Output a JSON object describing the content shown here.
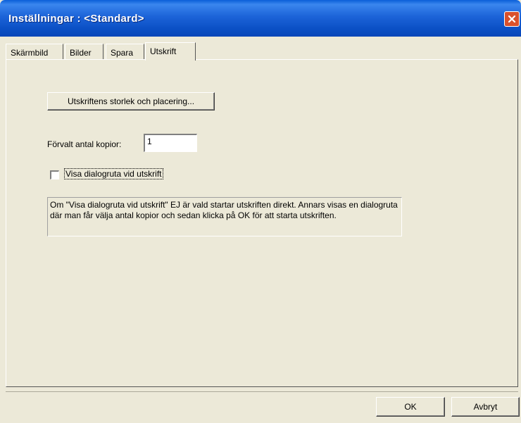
{
  "window": {
    "title": "Inställningar : <Standard>"
  },
  "tabs": [
    {
      "label": "Skärmbild"
    },
    {
      "label": "Bilder"
    },
    {
      "label": "Spara"
    },
    {
      "label": "Utskrift",
      "active": true
    }
  ],
  "print": {
    "size_button_label": "Utskriftens storlek och placering...",
    "copies_label": "Förvalt antal kopior:",
    "copies_value": "1",
    "dialog_checkbox_label": "Visa dialogruta vid utskrift",
    "dialog_checkbox_checked": false,
    "info_text": "Om \"Visa dialogruta vid utskrift\" EJ är vald startar utskriften direkt. Annars visas en dialogruta där man får välja antal kopior och sedan klicka på OK för att starta utskriften."
  },
  "footer": {
    "ok_label": "OK",
    "cancel_label": "Avbryt"
  },
  "colors": {
    "titlebar": "#0a4fc4",
    "close_button": "#d9512c",
    "dialog_background": "#ece9d8"
  },
  "icons": {
    "close": "close-icon"
  }
}
